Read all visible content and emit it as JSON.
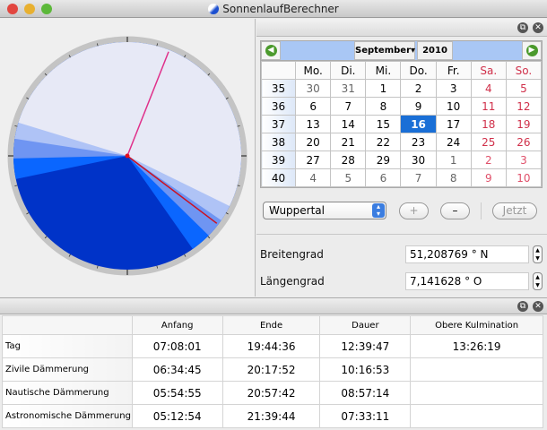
{
  "window": {
    "title": "SonnenlaufBerechner"
  },
  "calendar": {
    "month": "September",
    "year": "2010",
    "prev": "◀",
    "next": "▶",
    "weekdays": [
      "Mo.",
      "Di.",
      "Mi.",
      "Do.",
      "Fr.",
      "Sa.",
      "So."
    ],
    "weeks": [
      {
        "wk": "35",
        "days": [
          "30",
          "31",
          "1",
          "2",
          "3",
          "4",
          "5"
        ],
        "dim": [
          true,
          true,
          false,
          false,
          false,
          false,
          false
        ]
      },
      {
        "wk": "36",
        "days": [
          "6",
          "7",
          "8",
          "9",
          "10",
          "11",
          "12"
        ],
        "dim": [
          false,
          false,
          false,
          false,
          false,
          false,
          false
        ]
      },
      {
        "wk": "37",
        "days": [
          "13",
          "14",
          "15",
          "16",
          "17",
          "18",
          "19"
        ],
        "dim": [
          false,
          false,
          false,
          false,
          false,
          false,
          false
        ]
      },
      {
        "wk": "38",
        "days": [
          "20",
          "21",
          "22",
          "23",
          "24",
          "25",
          "26"
        ],
        "dim": [
          false,
          false,
          false,
          false,
          false,
          false,
          false
        ]
      },
      {
        "wk": "39",
        "days": [
          "27",
          "28",
          "29",
          "30",
          "1",
          "2",
          "3"
        ],
        "dim": [
          false,
          false,
          false,
          false,
          true,
          true,
          true
        ]
      },
      {
        "wk": "40",
        "days": [
          "4",
          "5",
          "6",
          "7",
          "8",
          "9",
          "10"
        ],
        "dim": [
          true,
          true,
          true,
          true,
          true,
          true,
          true
        ]
      }
    ],
    "selected": "16"
  },
  "location": {
    "city": "Wuppertal",
    "plus": "+",
    "minus": "–",
    "now": "Jetzt",
    "lat_label": "Breitengrad",
    "lat": "51,208769 ° N",
    "lon_label": "Längengrad",
    "lon": "7,141628 ° O"
  },
  "table": {
    "headers": [
      "",
      "Anfang",
      "Ende",
      "Dauer",
      "Obere Kulmination"
    ],
    "rows": [
      [
        "Tag",
        "07:08:01",
        "19:44:36",
        "12:39:47",
        "13:26:19"
      ],
      [
        "Zivile Dämmerung",
        "06:34:45",
        "20:17:52",
        "10:16:53",
        ""
      ],
      [
        "Nautische Dämmerung",
        "05:54:55",
        "20:57:42",
        "08:57:14",
        ""
      ],
      [
        "Astronomische Dämmerung",
        "05:12:54",
        "21:39:44",
        "07:33:11",
        ""
      ]
    ]
  },
  "dial": {
    "culmination_hours": 13.44,
    "current_hours": 20.47,
    "bands": [
      {
        "name": "astronomical",
        "start": 5.215,
        "end": 21.662,
        "color": "#0a66ff"
      },
      {
        "name": "nautical",
        "start": 5.915,
        "end": 20.962,
        "color": "#6f95f2"
      },
      {
        "name": "civil",
        "start": 6.579,
        "end": 20.298,
        "color": "#afc3f6"
      },
      {
        "name": "day",
        "start": 7.134,
        "end": 19.743,
        "color": "#e7e9f6"
      }
    ],
    "night_color": "#0033c8",
    "culmination_color": "#e0308a",
    "current_color": "#cc1020"
  }
}
